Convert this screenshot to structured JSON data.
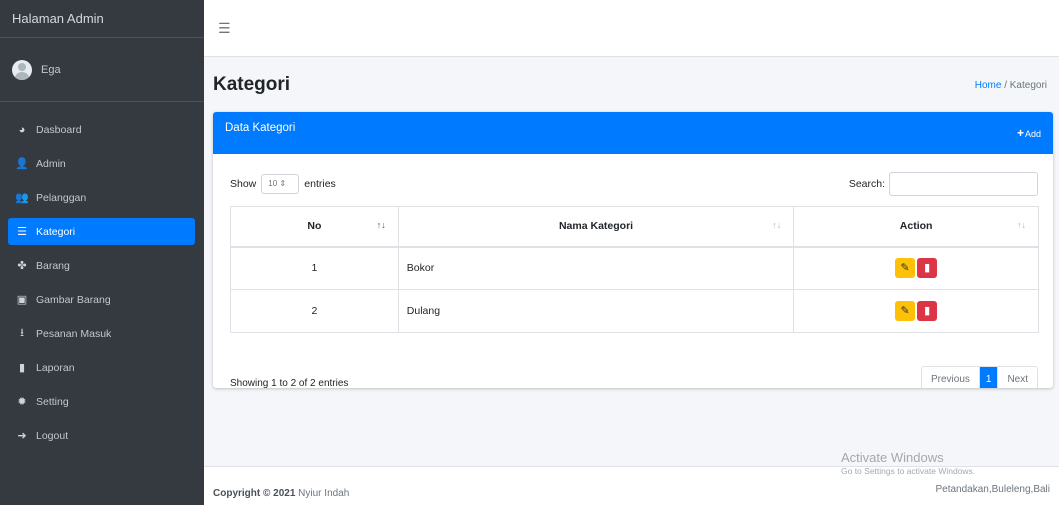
{
  "brand": "Halaman Admin",
  "user": {
    "name": "Ega"
  },
  "nav": [
    {
      "label": "Dasboard",
      "icon": "tachometer-icon",
      "glyph": "◕"
    },
    {
      "label": "Admin",
      "icon": "user-icon",
      "glyph": "👤"
    },
    {
      "label": "Pelanggan",
      "icon": "users-icon",
      "glyph": "👥"
    },
    {
      "label": "Kategori",
      "icon": "list-icon",
      "glyph": "☰"
    },
    {
      "label": "Barang",
      "icon": "shapes-icon",
      "glyph": "✤"
    },
    {
      "label": "Gambar Barang",
      "icon": "image-icon",
      "glyph": "▣"
    },
    {
      "label": "Pesanan Masuk",
      "icon": "download-icon",
      "glyph": "⭳"
    },
    {
      "label": "Laporan",
      "icon": "file-icon",
      "glyph": "▮"
    },
    {
      "label": "Setting",
      "icon": "gear-icon",
      "glyph": "✹"
    },
    {
      "label": "Logout",
      "icon": "sign-out-icon",
      "glyph": "➜"
    }
  ],
  "page": {
    "title": "Kategori"
  },
  "breadcrumb": {
    "home": "Home",
    "sep": "/",
    "current": "Kategori"
  },
  "card": {
    "title": "Data Kategori",
    "add_label": "Add"
  },
  "length": {
    "show": "Show",
    "value": "10",
    "entries": "entries"
  },
  "search": {
    "label": "Search:",
    "value": ""
  },
  "table": {
    "headers": {
      "no": "No",
      "nama": "Nama Kategori",
      "action": "Action"
    },
    "rows": [
      {
        "no": "1",
        "nama": "Bokor"
      },
      {
        "no": "2",
        "nama": "Dulang"
      }
    ]
  },
  "info": "Showing 1 to 2 of 2 entries",
  "pagination": {
    "previous": "Previous",
    "current": "1",
    "next": "Next"
  },
  "footer": {
    "copyright_label": "Copyright © 2021",
    "owner": "Nyiur Indah",
    "location": "Petandakan,Buleleng,Bali"
  },
  "watermark": {
    "line1": "Activate Windows",
    "line2": "Go to Settings to activate Windows."
  },
  "colors": {
    "sidebar": "#343a40",
    "primary": "#007bff",
    "warning": "#ffc107",
    "danger": "#dc3545"
  }
}
